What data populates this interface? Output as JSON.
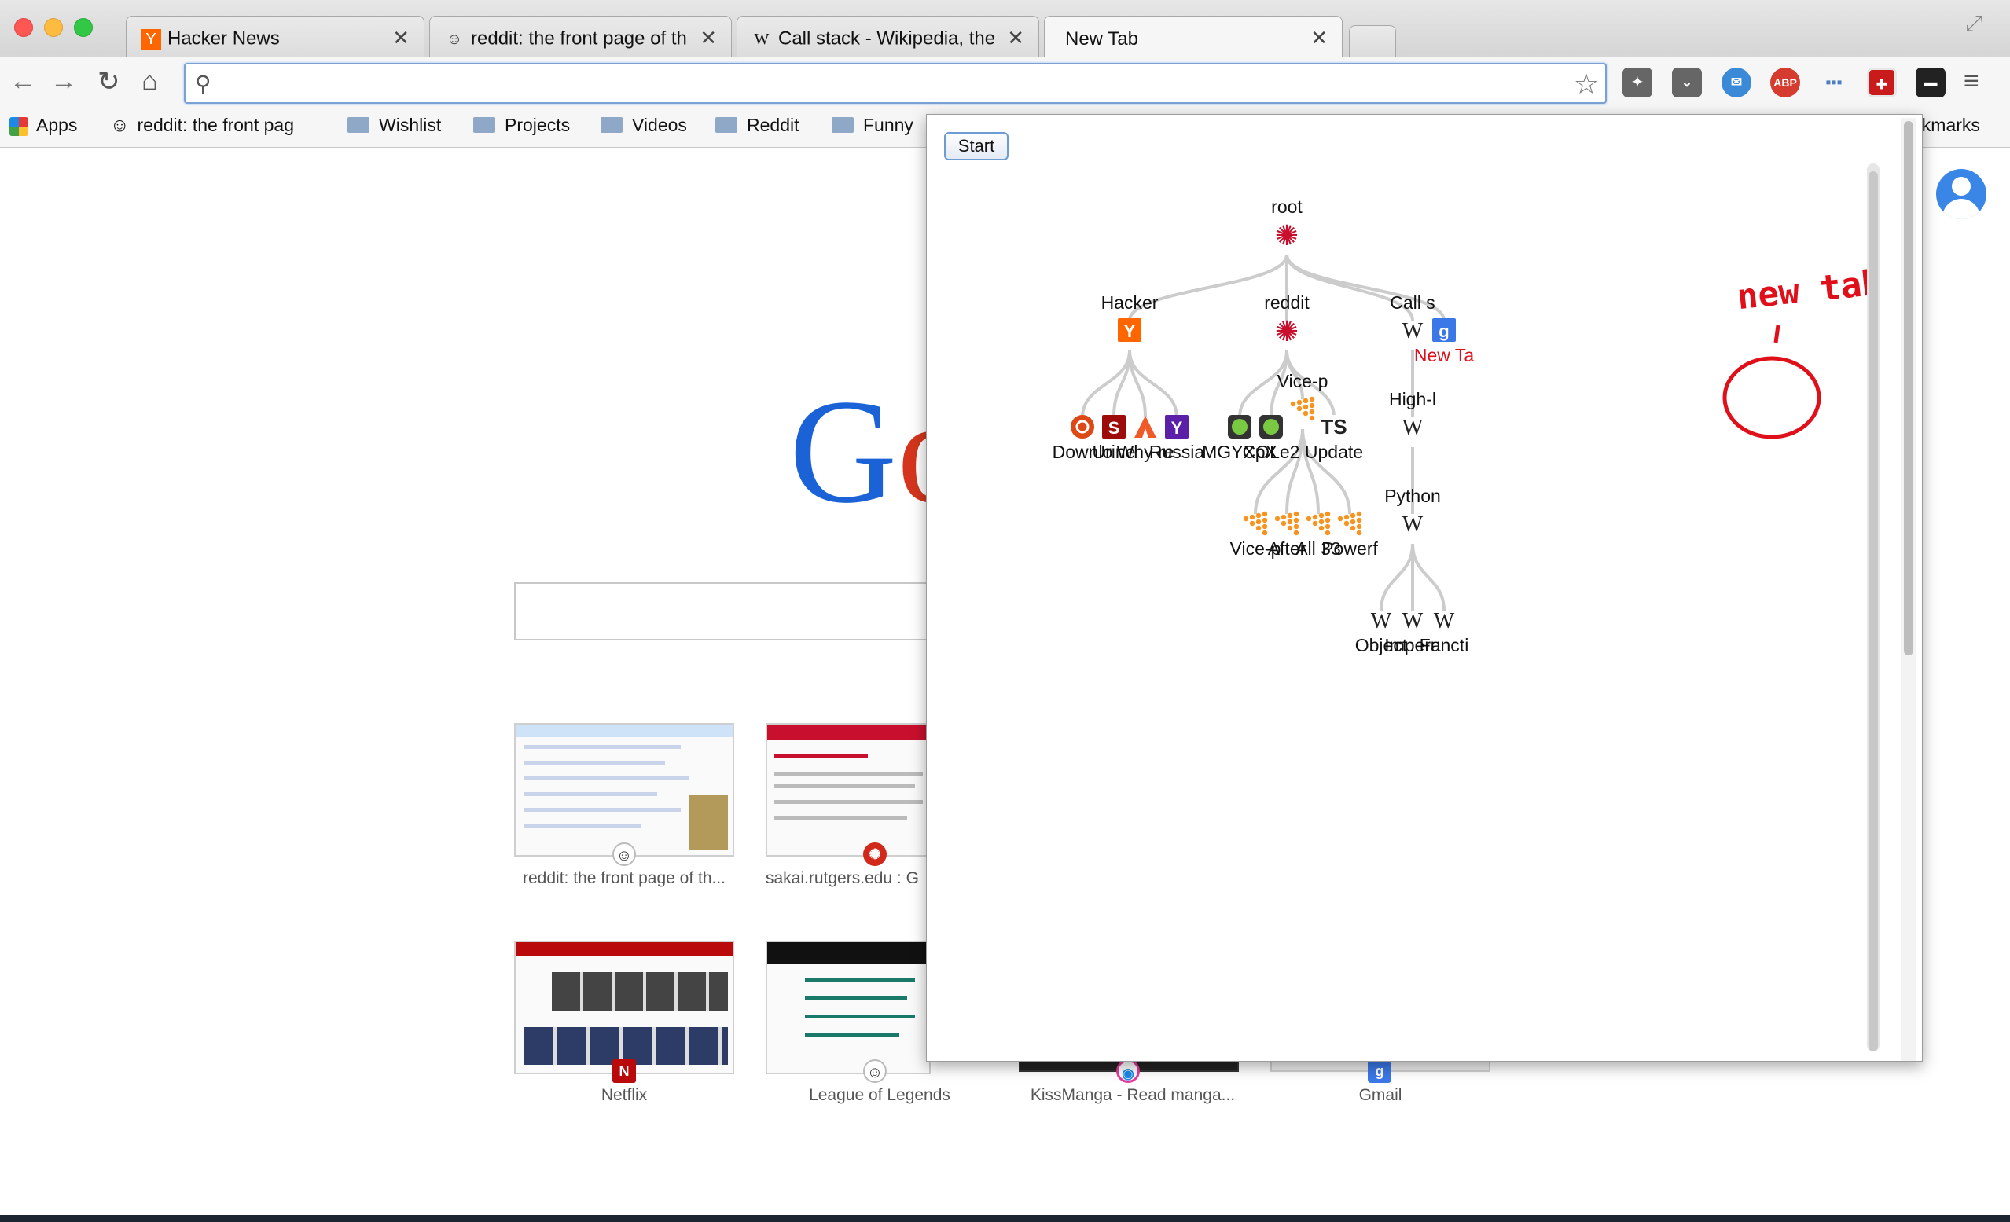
{
  "tabs": [
    {
      "title": "Hacker News",
      "favicon": "Y",
      "color": "#ff6600"
    },
    {
      "title": "reddit: the front page of th",
      "favicon": "reddit-alien-icon",
      "color": "#ffffff"
    },
    {
      "title": "Call stack - Wikipedia, the",
      "favicon": "W",
      "color": "#ffffff"
    },
    {
      "title": "New Tab",
      "favicon": "",
      "color": "#ffffff"
    }
  ],
  "bookmarks": {
    "apps": "Apps",
    "reddit": "reddit: the front pag",
    "folders": [
      "Wishlist",
      "Projects",
      "Videos",
      "Reddit",
      "Funny"
    ],
    "other": "okmarks"
  },
  "extensions": [
    {
      "name": "puzzle-icon",
      "text": "",
      "color": "#555555"
    },
    {
      "name": "pocket-icon",
      "text": "",
      "color": "#666666"
    },
    {
      "name": "chat-icon",
      "text": "",
      "color": "#3b8ad8"
    },
    {
      "name": "adblock-icon",
      "text": "ABP",
      "color": "#d53b2e"
    },
    {
      "name": "dots-icon",
      "text": "",
      "color": "#4a7ec0"
    },
    {
      "name": "tab-tree-icon",
      "text": "",
      "color": "#c91b1b"
    },
    {
      "name": "mask-icon",
      "text": "",
      "color": "#222222"
    }
  ],
  "popup": {
    "start_label": "Start",
    "annotation": "new tab",
    "nodes": [
      {
        "id": "root",
        "label": "root",
        "icon": "maple",
        "parent": null
      },
      {
        "id": "hn",
        "label": "Hacker",
        "icon": "Y",
        "parent": "root"
      },
      {
        "id": "reddit",
        "label": "reddit",
        "icon": "maple",
        "parent": "root"
      },
      {
        "id": "calls",
        "label": "Call s",
        "icon": "W",
        "parent": "root"
      },
      {
        "id": "newtab",
        "label": "New Ta",
        "icon": "g",
        "parent": "root",
        "highlight": true
      },
      {
        "id": "dl",
        "label": "Downlo",
        "icon": "ubuntu",
        "parent": "hn"
      },
      {
        "id": "urine",
        "label": "Urine",
        "icon": "S",
        "parent": "hn"
      },
      {
        "id": "why",
        "label": "Why re",
        "icon": "flame",
        "parent": "hn"
      },
      {
        "id": "russia",
        "label": "Russia",
        "icon": "Y",
        "parent": "hn"
      },
      {
        "id": "mgy",
        "label": "MGYXpX",
        "icon": "green",
        "parent": "reddit"
      },
      {
        "id": "col",
        "label": "COLe2",
        "icon": "green",
        "parent": "reddit"
      },
      {
        "id": "vice",
        "label": "Vice-p",
        "icon": "dots",
        "parent": "reddit"
      },
      {
        "id": "ts",
        "label": "Update",
        "icon": "TS",
        "parent": "reddit"
      },
      {
        "id": "vice2",
        "label": "Vice-p",
        "icon": "dots",
        "parent": "vice"
      },
      {
        "id": "after",
        "label": "After",
        "icon": "dots",
        "parent": "vice"
      },
      {
        "id": "all33",
        "label": "All 33",
        "icon": "dots",
        "parent": "vice"
      },
      {
        "id": "powerf",
        "label": "Powerf",
        "icon": "dots",
        "parent": "vice"
      },
      {
        "id": "highl",
        "label": "High-l",
        "icon": "W",
        "parent": "calls"
      },
      {
        "id": "python",
        "label": "Python",
        "icon": "W",
        "parent": "highl"
      },
      {
        "id": "object",
        "label": "Object",
        "icon": "W",
        "parent": "python"
      },
      {
        "id": "impera",
        "label": "Impera",
        "icon": "W",
        "parent": "python"
      },
      {
        "id": "functi",
        "label": "Functi",
        "icon": "W",
        "parent": "python"
      }
    ]
  },
  "thumbnails": [
    {
      "label": "reddit: the front page of th...",
      "icon": "reddit-alien-icon"
    },
    {
      "label": "sakai.rutgers.edu : G",
      "icon": "sakai-icon"
    },
    {
      "label": "Netflix",
      "icon": "N"
    },
    {
      "label": "League of Legends",
      "icon": "reddit-alien-icon"
    },
    {
      "label": "KissManga - Read manga...",
      "icon": "kissmanga-icon"
    },
    {
      "label": "Gmail",
      "icon": "g"
    }
  ],
  "google_logo": {
    "text": "Go",
    "colors": [
      "#1a62d6",
      "#d4351c"
    ]
  }
}
